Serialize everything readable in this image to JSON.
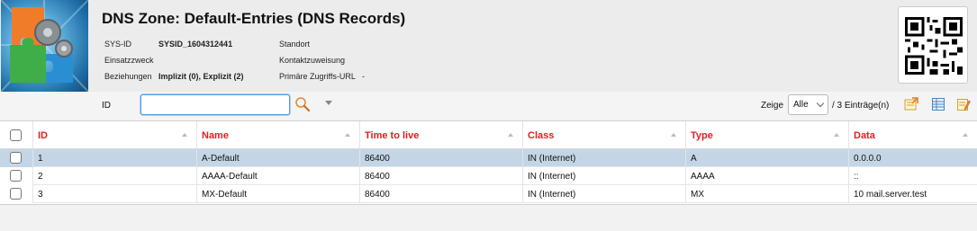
{
  "page": {
    "title": "DNS Zone: Default-Entries (DNS Records)"
  },
  "meta": {
    "sysid_label": "SYS-ID",
    "sysid_value": "SYSID_1604312441",
    "einsatzzweck_label": "Einsatzzweck",
    "beziehungen_label": "Beziehungen",
    "beziehungen_value": "Implizit (0), Explizit (2)",
    "standort_label": "Standort",
    "kontakt_label": "Kontaktzuweisung",
    "url_label": "Primäre Zugriffs-URL",
    "url_value": "-"
  },
  "toolbar": {
    "id_label": "ID",
    "search_value": "",
    "zeige_label": "Zeige",
    "zeige_value": "Alle",
    "count_text": "/ 3 Einträge(n)"
  },
  "table": {
    "columns": [
      "ID",
      "Name",
      "Time to live",
      "Class",
      "Type",
      "Data"
    ],
    "rows": [
      {
        "id": "1",
        "name": "A-Default",
        "ttl": "86400",
        "class": "IN (Internet)",
        "type": "A",
        "data": "0.0.0.0",
        "selected": true
      },
      {
        "id": "2",
        "name": "AAAA-Default",
        "ttl": "86400",
        "class": "IN (Internet)",
        "type": "AAAA",
        "data": "::",
        "selected": false
      },
      {
        "id": "3",
        "name": "MX-Default",
        "ttl": "86400",
        "class": "IN (Internet)",
        "type": "MX",
        "data": "10 mail.server.test",
        "selected": false
      }
    ]
  },
  "colors": {
    "header_text": "#e0201f",
    "selected_row": "#c4d6e6",
    "input_focus": "#5a9bd8"
  },
  "icons": [
    "puzzle-logo-icon",
    "qr-code-icon",
    "magnifier-icon",
    "dropdown-arrow-icon",
    "export-icon",
    "table-view-icon",
    "edit-list-icon"
  ]
}
